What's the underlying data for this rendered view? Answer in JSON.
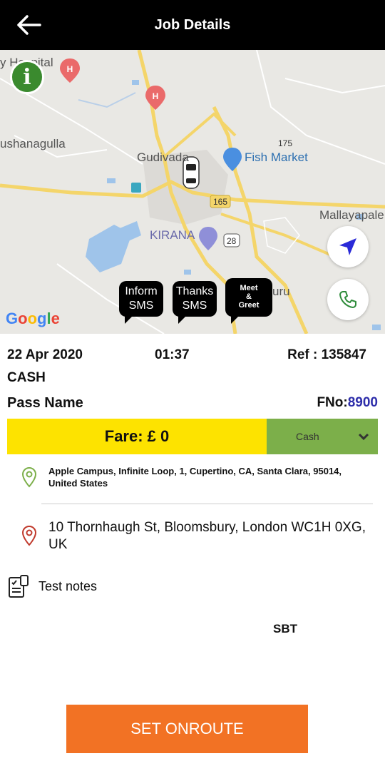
{
  "header": {
    "title": "Job Details",
    "back_icon": "back-arrow-icon"
  },
  "map": {
    "labels": {
      "hospital": "y Hospital",
      "town_left": "ushanagulla",
      "town_center": "Gudivada",
      "shop": "Fish Market",
      "road_175": "175",
      "road_165": "165",
      "road_28": "28",
      "town_right": "Mallayapale",
      "kirana": "KIRANA",
      "uru": "uru",
      "google": "Google"
    },
    "buttons": {
      "inform_sms": [
        "Inform",
        "SMS"
      ],
      "thanks_sms": [
        "Thanks",
        "SMS"
      ],
      "meet_greet": [
        "Meet",
        "&",
        "Greet"
      ]
    },
    "icons": {
      "info": "info-icon",
      "navigate": "navigation-arrow-icon",
      "call": "phone-icon",
      "car": "car-icon"
    }
  },
  "job": {
    "date": "22 Apr 2020",
    "time": "01:37",
    "ref": "Ref : 135847",
    "payment_type": "CASH",
    "passenger": "Pass Name",
    "fno_label": "FNo:",
    "fno_value": "8900",
    "fare": "Fare: £ 0",
    "payment_method_selected": "Cash",
    "pickup": "Apple Campus, Infinite Loop, 1, Cupertino, CA, Santa Clara, 95014, United States",
    "dropoff": "10 Thornhaugh St, Bloomsbury, London WC1H 0XG, UK",
    "notes": "Test notes",
    "vehicle": "SBT"
  },
  "action": {
    "label": "SET ONROUTE"
  },
  "colors": {
    "header": "#000000",
    "fare_bg": "#fde300",
    "payment_bg": "#7caf4a",
    "cta": "#f27224",
    "fno_value": "#2e2eaa",
    "pickup_pin": "#7caf4a",
    "dropoff_pin": "#c0392b"
  }
}
